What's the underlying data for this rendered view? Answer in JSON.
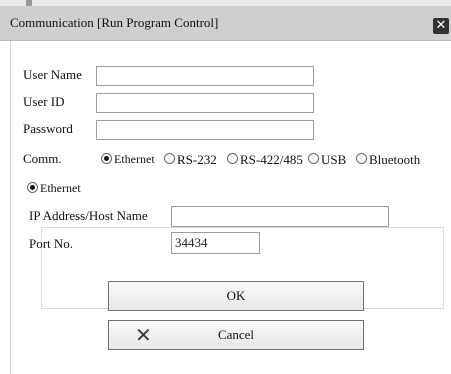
{
  "dialog": {
    "title": "Communication [Run Program Control]",
    "close_glyph": "✕"
  },
  "form": {
    "user_name_label": "User Name",
    "user_name_value": "",
    "user_id_label": "User ID",
    "user_id_value": "",
    "password_label": "Password",
    "password_value": "",
    "comm_label": "Comm."
  },
  "comm_options": [
    {
      "label": "Ethernet",
      "selected": true
    },
    {
      "label": "RS-232",
      "selected": false
    },
    {
      "label": "RS-422/485",
      "selected": false
    },
    {
      "label": "USB",
      "selected": false
    },
    {
      "label": "Bluetooth",
      "selected": false
    }
  ],
  "ethernet_group": {
    "title": "Ethernet",
    "ip_label": "IP Address/Host Name",
    "ip_value": "",
    "port_label": "Port No.",
    "port_value": "34434"
  },
  "buttons": {
    "ok": "OK",
    "cancel": "Cancel",
    "cancel_icon": "✕"
  },
  "icons": {
    "close": "close-icon",
    "cancel": "x-icon"
  }
}
